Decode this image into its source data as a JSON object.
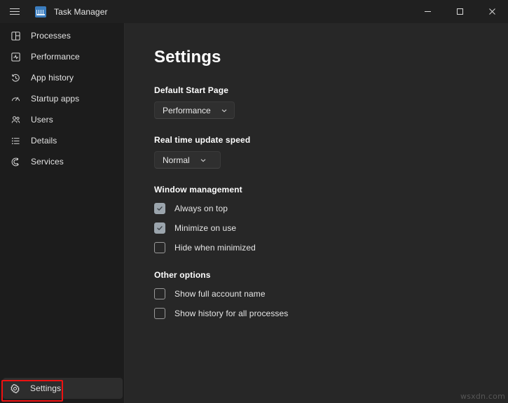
{
  "titlebar": {
    "menu_icon": "hamburger-icon",
    "app_icon": "task-manager-icon",
    "title": "Task Manager",
    "minimize_label": "─",
    "maximize_label": "☐",
    "close_label": "✕"
  },
  "sidebar": {
    "items": [
      {
        "label": "Processes",
        "icon": "processes-icon"
      },
      {
        "label": "Performance",
        "icon": "performance-icon"
      },
      {
        "label": "App history",
        "icon": "app-history-icon"
      },
      {
        "label": "Startup apps",
        "icon": "startup-apps-icon"
      },
      {
        "label": "Users",
        "icon": "users-icon"
      },
      {
        "label": "Details",
        "icon": "details-icon"
      },
      {
        "label": "Services",
        "icon": "services-icon"
      }
    ],
    "settings": {
      "label": "Settings",
      "icon": "gear-icon",
      "selected": true
    }
  },
  "main": {
    "title": "Settings",
    "sections": [
      {
        "heading": "Default Start Page",
        "control": "dropdown",
        "value": "Performance"
      },
      {
        "heading": "Real time update speed",
        "control": "dropdown",
        "value": "Normal"
      },
      {
        "heading": "Window management",
        "control": "checkboxes",
        "options": [
          {
            "label": "Always on top",
            "checked": true
          },
          {
            "label": "Minimize on use",
            "checked": true
          },
          {
            "label": "Hide when minimized",
            "checked": false
          }
        ]
      },
      {
        "heading": "Other options",
        "control": "checkboxes",
        "options": [
          {
            "label": "Show full account name",
            "checked": false
          },
          {
            "label": "Show history for all processes",
            "checked": false
          }
        ]
      }
    ]
  },
  "annotation": {
    "color": "#ee1111",
    "target": "settings"
  },
  "watermark": "wsxdn.com",
  "colors": {
    "titlebar_bg": "#202020",
    "sidebar_bg": "#1c1c1c",
    "content_bg": "#272727",
    "selected_bg": "#2d2d2d",
    "checkbox_on": "#9ba5ad",
    "accent_red": "#ee1111"
  }
}
